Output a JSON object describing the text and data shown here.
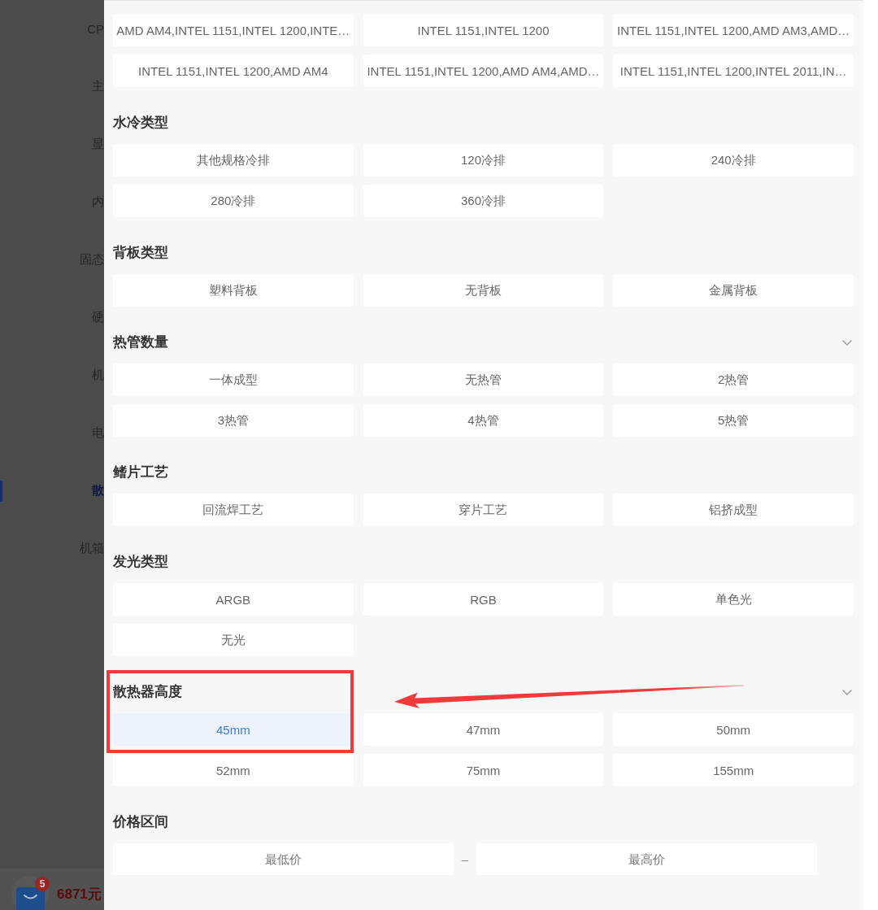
{
  "sidebar": {
    "items": [
      {
        "label": "CP",
        "selected": false
      },
      {
        "label": "主",
        "selected": false
      },
      {
        "label": "显",
        "selected": false
      },
      {
        "label": "内",
        "selected": false
      },
      {
        "label": "固态",
        "selected": false
      },
      {
        "label": "硬",
        "selected": false
      },
      {
        "label": "机",
        "selected": false
      },
      {
        "label": "电",
        "selected": false
      },
      {
        "label": "散",
        "selected": true
      },
      {
        "label": "机箱",
        "selected": false
      }
    ]
  },
  "cart": {
    "badge": "5",
    "total": "6871元"
  },
  "filter_sections": [
    {
      "collapsed": false,
      "highlighted": false,
      "options": [
        {
          "label": "AMD AM4,INTEL 1151,INTEL 1200,INTE…",
          "selected": false
        },
        {
          "label": "INTEL 1151,INTEL 1200",
          "selected": false
        },
        {
          "label": "INTEL 1151,INTEL 1200,AMD AM3,AMD…",
          "selected": false
        },
        {
          "label": "INTEL 1151,INTEL 1200,AMD AM4",
          "selected": false
        },
        {
          "label": "INTEL 1151,INTEL 1200,AMD AM4,AMD…",
          "selected": false
        },
        {
          "label": "INTEL 1151,INTEL 1200,INTEL 2011,IN…",
          "selected": false
        }
      ]
    },
    {
      "title": "水冷类型",
      "collapsed": false,
      "highlighted": false,
      "options": [
        {
          "label": "其他规格冷排",
          "selected": false
        },
        {
          "label": "120冷排",
          "selected": false
        },
        {
          "label": "240冷排",
          "selected": false
        },
        {
          "label": "280冷排",
          "selected": false
        },
        {
          "label": "360冷排",
          "selected": false
        }
      ]
    },
    {
      "title": "背板类型",
      "collapsed": false,
      "highlighted": false,
      "options": [
        {
          "label": "塑料背板",
          "selected": false
        },
        {
          "label": "无背板",
          "selected": false
        },
        {
          "label": "金属背板",
          "selected": false
        }
      ]
    },
    {
      "title": "热管数量",
      "collapsed": true,
      "highlighted": false,
      "options": [
        {
          "label": "一体成型",
          "selected": false
        },
        {
          "label": "无热管",
          "selected": false
        },
        {
          "label": "2热管",
          "selected": false
        },
        {
          "label": "3热管",
          "selected": false
        },
        {
          "label": "4热管",
          "selected": false
        },
        {
          "label": "5热管",
          "selected": false
        }
      ]
    },
    {
      "title": "鳍片工艺",
      "collapsed": false,
      "highlighted": false,
      "options": [
        {
          "label": "回流焊工艺",
          "selected": false
        },
        {
          "label": "穿片工艺",
          "selected": false
        },
        {
          "label": "铝挤成型",
          "selected": false
        }
      ]
    },
    {
      "title": "发光类型",
      "collapsed": false,
      "highlighted": false,
      "options": [
        {
          "label": "ARGB",
          "selected": false
        },
        {
          "label": "RGB",
          "selected": false
        },
        {
          "label": "单色光",
          "selected": false
        },
        {
          "label": "无光",
          "selected": false
        }
      ]
    },
    {
      "title": "散热器高度",
      "collapsed": true,
      "highlighted": true,
      "options": [
        {
          "label": "45mm",
          "selected": true
        },
        {
          "label": "47mm",
          "selected": false
        },
        {
          "label": "50mm",
          "selected": false
        },
        {
          "label": "52mm",
          "selected": false
        },
        {
          "label": "75mm",
          "selected": false
        },
        {
          "label": "155mm",
          "selected": false
        }
      ]
    }
  ],
  "price_range": {
    "title": "价格区间",
    "min": {
      "placeholder": "最低价"
    },
    "separator": "–",
    "max": {
      "placeholder": "最高价"
    }
  }
}
